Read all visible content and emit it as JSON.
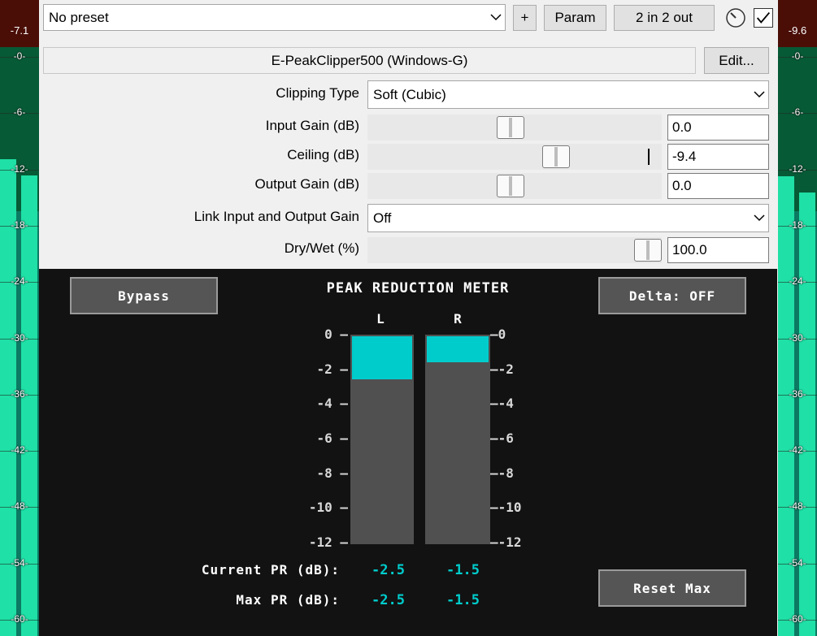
{
  "meters": {
    "left": {
      "peak": "-7.1",
      "level": 0.81
    },
    "right": {
      "peak": "-9.6",
      "level": 0.78
    },
    "scale": [
      "-0-",
      "-6-",
      "-12-",
      "-18-",
      "-24-",
      "-30-",
      "-36-",
      "-42-",
      "-48-",
      "-54-",
      "-60-"
    ]
  },
  "header": {
    "preset_value": "No preset",
    "add_button": "+",
    "param_button": "Param",
    "io_button": "2 in 2 out",
    "plugin_name": "E-PeakClipper500 (Windows-G)",
    "edit_button": "Edit..."
  },
  "params": {
    "clipping_type": {
      "label": "Clipping Type",
      "value": "Soft (Cubic)"
    },
    "input_gain": {
      "label": "Input Gain (dB)",
      "value": "0.0",
      "slider": 0.485
    },
    "ceiling": {
      "label": "Ceiling (dB)",
      "value": "-9.4",
      "slider": 0.655
    },
    "output_gain": {
      "label": "Output Gain (dB)",
      "value": "0.0",
      "slider": 0.485
    },
    "link_gain": {
      "label": "Link Input and Output Gain",
      "value": "Off"
    },
    "dry_wet": {
      "label": "Dry/Wet (%)",
      "value": "100.0",
      "slider": 1.0
    }
  },
  "panel": {
    "bypass_button": "Bypass",
    "title": "PEAK REDUCTION METER",
    "delta_button": "Delta: OFF",
    "reset_button": "Reset Max",
    "left_channel": "L",
    "right_channel": "R",
    "ticks": [
      "0",
      "-2",
      "-4",
      "-6",
      "-8",
      "-10",
      "-12"
    ],
    "reduction_range_db": 12,
    "current_pr_label": "Current PR (dB):",
    "max_pr_label": "Max PR (dB):",
    "current_left": "-2.5",
    "current_right": "-1.5",
    "max_left": "-2.5",
    "max_right": "-1.5",
    "left_reduction": 2.5,
    "right_reduction": 1.5
  },
  "colors": {
    "meter_fill": "#1fe0a6",
    "meter_dark": "#075a36",
    "peak_red": "#4a0e07",
    "reduction_cyan": "#00cccc"
  }
}
